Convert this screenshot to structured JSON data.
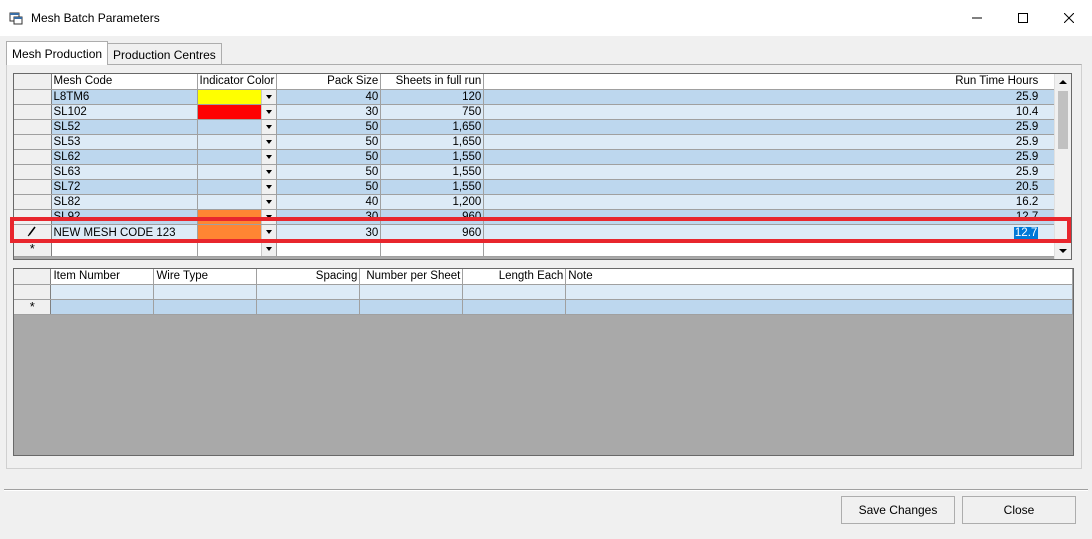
{
  "window": {
    "title": "Mesh Batch Parameters"
  },
  "tabs": [
    {
      "label": "Mesh Production",
      "active": true
    },
    {
      "label": "Production Centres",
      "active": false
    }
  ],
  "mesh_grid": {
    "columns": [
      "Mesh Code",
      "Indicator Color",
      "Pack Size",
      "Sheets in full run",
      "Run Time Hours"
    ],
    "rows": [
      {
        "code": "L8TM6",
        "color": "#ffff00",
        "pack": "40",
        "sheets": "120",
        "hours": "25.9"
      },
      {
        "code": "SL102",
        "color": "#ff0000",
        "pack": "30",
        "sheets": "750",
        "hours": "10.4"
      },
      {
        "code": "SL52",
        "color": "",
        "pack": "50",
        "sheets": "1,650",
        "hours": "25.9"
      },
      {
        "code": "SL53",
        "color": "",
        "pack": "50",
        "sheets": "1,650",
        "hours": "25.9"
      },
      {
        "code": "SL62",
        "color": "",
        "pack": "50",
        "sheets": "1,550",
        "hours": "25.9"
      },
      {
        "code": "SL63",
        "color": "",
        "pack": "50",
        "sheets": "1,550",
        "hours": "25.9"
      },
      {
        "code": "SL72",
        "color": "",
        "pack": "50",
        "sheets": "1,550",
        "hours": "20.5"
      },
      {
        "code": "SL82",
        "color": "",
        "pack": "40",
        "sheets": "1,200",
        "hours": "16.2"
      },
      {
        "code": "SL92",
        "color": "#ff8533",
        "pack": "30",
        "sheets": "960",
        "hours": "12.7"
      }
    ],
    "editing_row": {
      "code": "NEW MESH CODE 123",
      "color": "#ff8533",
      "pack": "30",
      "sheets": "960",
      "hours": "12.7"
    },
    "new_row_marker": "*"
  },
  "items_grid": {
    "columns": [
      "Item Number",
      "Wire Type",
      "Spacing",
      "Number per Sheet",
      "Length Each",
      "Note"
    ],
    "new_row_marker": "*"
  },
  "buttons": {
    "save": "Save Changes",
    "close": "Close"
  },
  "colors": {
    "row_alt": "#bdd7ee",
    "row_norm": "#ddebf7",
    "highlight": "#e8262d",
    "selection": "#0078d7"
  }
}
